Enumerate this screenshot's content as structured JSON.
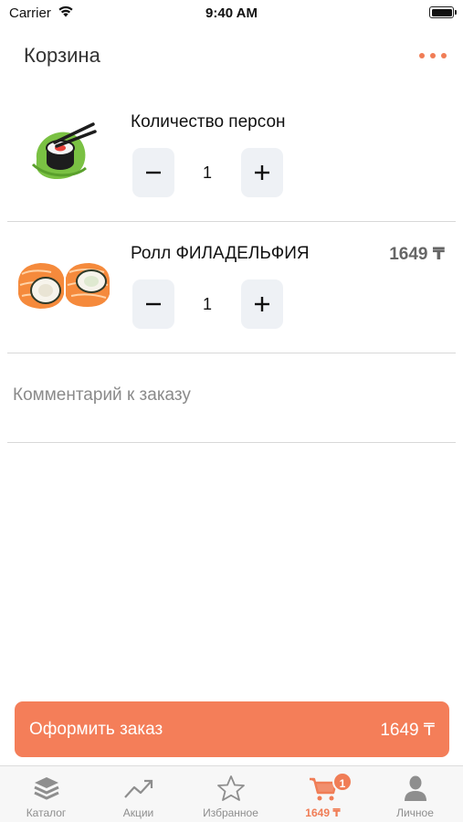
{
  "status_bar": {
    "carrier": "Carrier",
    "time": "9:40 AM"
  },
  "header": {
    "title": "Корзина"
  },
  "cart": {
    "items": [
      {
        "name": "Количество персон",
        "quantity": "1",
        "price": "",
        "image_icon": "sushi-chopsticks-logo-icon"
      },
      {
        "name": "Ролл ФИЛАДЕЛЬФИЯ",
        "quantity": "1",
        "price": "1649 ₸",
        "image_icon": "philadelphia-roll-image"
      }
    ],
    "comment_placeholder": "Комментарий к заказу"
  },
  "checkout": {
    "label": "Оформить заказ",
    "total": "1649 ₸"
  },
  "tabbar": {
    "tabs": [
      {
        "label": "Каталог",
        "icon": "layers-icon",
        "active": false
      },
      {
        "label": "Акции",
        "icon": "trending-up-icon",
        "active": false
      },
      {
        "label": "Избранное",
        "icon": "star-icon",
        "active": false
      },
      {
        "label": "1649 ₸",
        "icon": "cart-icon",
        "active": true,
        "badge": "1"
      },
      {
        "label": "Личное",
        "icon": "person-icon",
        "active": false
      }
    ]
  },
  "colors": {
    "accent": "#f47e59",
    "stepper_bg": "#eef1f5",
    "divider": "#d8d8d8"
  }
}
